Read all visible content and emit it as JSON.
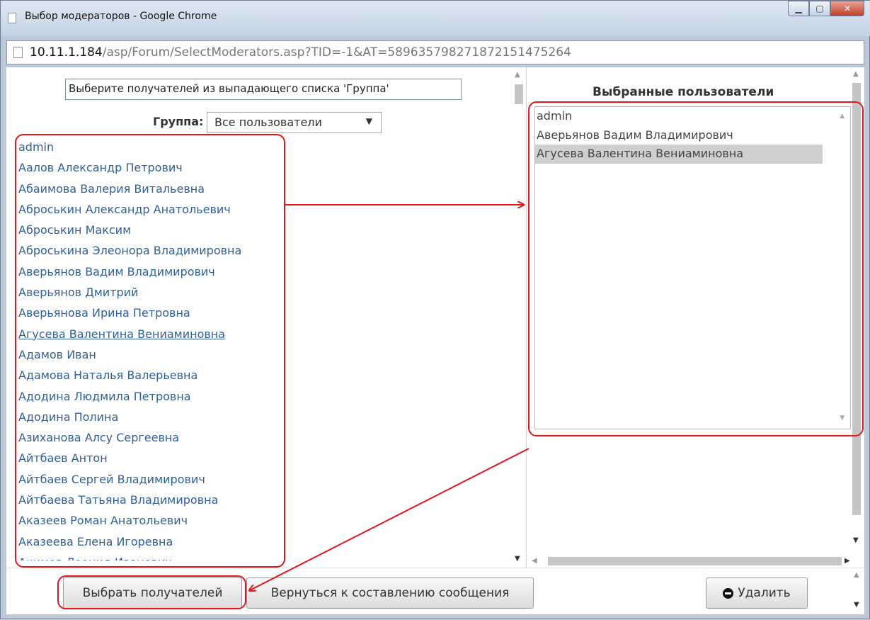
{
  "window": {
    "title": "Выбор модераторов - Google Chrome",
    "url_host": "10.11.1.184",
    "url_path": "/asp/Forum/SelectModerators.asp?TID=-1&AT=5896357982718721514752​64"
  },
  "left": {
    "hint": "Выберите получателей из выпадающего списка 'Группа'",
    "group_label": "Группа:",
    "group_value": "Все пользователи",
    "users": [
      "admin",
      "Аалов Александр Петрович",
      "Абаимова Валерия Витальевна",
      "Аброськин Александр Анатольевич",
      "Аброськин Максим",
      "Аброськина Элеонора Владимировна",
      "Аверьянов Вадим Владимирович",
      "Аверьянов Дмитрий",
      "Аверьянова Ирина Петровна",
      "Агусева Валентина Вениаминовна",
      "Адамов Иван",
      "Адамова Наталья Валерьевна",
      "Адодина Людмила Петровна",
      "Адодина Полина",
      "Азиханова Алсу Сергеевна",
      "Айтбаев Антон",
      "Айтбаев Сергей Владимирович",
      "Айтбаева Татьяна Владимировна",
      "Аказеев Роман Анатольевич",
      "Аказеева Елена Игоревна",
      "Акимов Леонид Иванович"
    ]
  },
  "right": {
    "title": "Выбранные пользователи",
    "selected": [
      "admin",
      "Аверьянов Вадим Владимирович",
      "Агусева Валентина Вениаминовна"
    ]
  },
  "buttons": {
    "choose": "Выбрать получателей",
    "back": "Вернуться к составлению сообщения",
    "delete": "Удалить"
  },
  "colors": {
    "link": "#305f9e",
    "annotation": "#e8141a",
    "highlight": "#cfcfcf"
  }
}
